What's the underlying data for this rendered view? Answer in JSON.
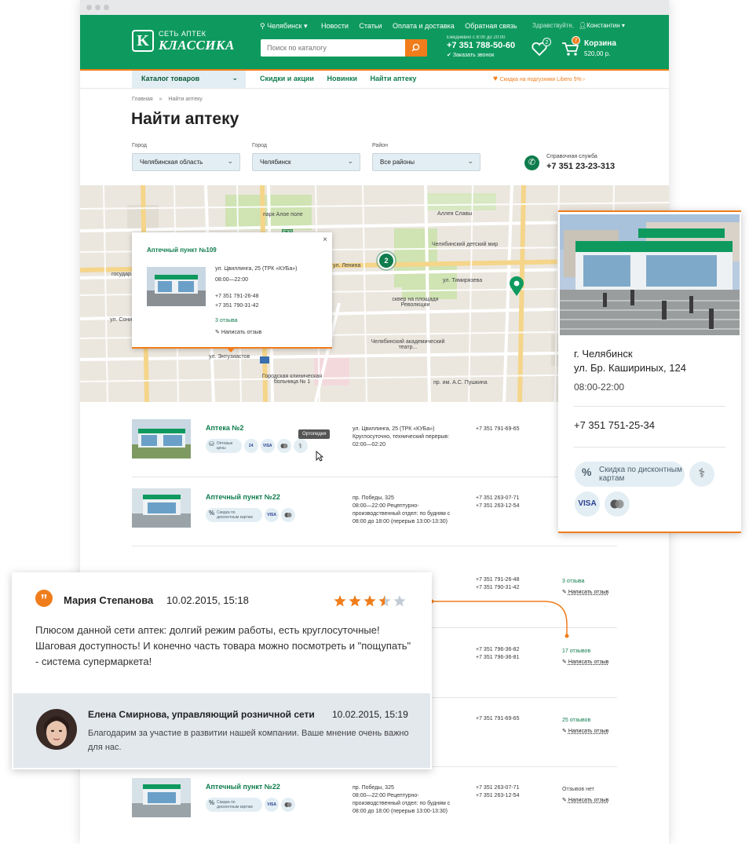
{
  "header": {
    "logo_line1": "СЕТЬ АПТЕК",
    "logo_line2": "КЛАССИКА",
    "city": "Челябинск",
    "nav": [
      "Новости",
      "Статьи",
      "Оплата и доставка",
      "Обратная связь"
    ],
    "search_placeholder": "Поиск по каталогу",
    "phone_schedule": "Ежедневно с 8:00 до 20:00",
    "phone": "+7 351 788-50-60",
    "callback": "Заказать звонок",
    "greeting": "Здравствуйте,",
    "user": "Константин",
    "favorites_count": "2",
    "cart_count": "7",
    "cart_label": "Корзина",
    "cart_sum": "520,00 р.",
    "colors": {
      "brand_green": "#0e9a5e",
      "accent_orange": "#f07d1b"
    }
  },
  "subnav": {
    "catalog": "Каталог товаров",
    "links": [
      "Скидки и акции",
      "Новинки",
      "Найти аптеку"
    ],
    "promo": "Скидка на подгузники Libero 5%"
  },
  "page": {
    "breadcrumb_home": "Главная",
    "breadcrumb_sep": "»",
    "breadcrumb_current": "Найти аптеку",
    "title": "Найти аптеку",
    "filters": [
      {
        "label": "Город",
        "value": "Челябинская область"
      },
      {
        "label": "Город",
        "value": "Челябинск"
      },
      {
        "label": "Район",
        "value": "Все районы"
      }
    ],
    "help_label": "Справочная служба",
    "help_phone": "+7 351 23-23-313"
  },
  "map": {
    "labels": [
      "парк Алое поле",
      "Аллея Славы",
      "ул. Коммуны",
      "ул. Свободы",
      "ул. Ленина",
      "ул. Тимирязева",
      "сквер на площади Революции",
      "Челябинский детский мир",
      "Челябинский академический театр...",
      "Городская клиническая больница № 1",
      "пр. им. А.С. Пушкина",
      "ул. Воровского",
      "ул. Лесной",
      "ул. Энтузиастов",
      "государ...",
      "ул. Сони",
      "ул. Худякова",
      "ул. Кирова",
      "M5",
      "E30"
    ],
    "cluster_count": "2",
    "popup": {
      "title": "Аптечный пункт №109",
      "address": "ул. Цвиллинга, 25 (ТРК «КУБа»)",
      "hours": "08:00—22:00",
      "phone1": "+7 351 791-26-48",
      "phone2": "+7 351 790-31-42",
      "reviews": "3 отзыва",
      "write": "Написать отзыв",
      "close": "×"
    }
  },
  "list": [
    {
      "name": "Аптека №2",
      "badges": [
        "Оптовые цены",
        "24",
        "VISA",
        "mc",
        "ortho"
      ],
      "address": "ул. Цвиллинга, 25 (ТРК «КУБа»)",
      "hours": "Круглосуточно, технический перерыв: 02:00—02:20",
      "phones": [
        "+7 351 791-69-65"
      ],
      "reviews": "",
      "write": ""
    },
    {
      "name": "Аптечный пункт №22",
      "badges": [
        "Скидка по дисконтным картам",
        "VISA",
        "mc"
      ],
      "address": "пр. Победы, 325",
      "hours": "08:00—22:00 Рецептурно-производственный отдел: по будням с 08:00 до 18:00 (перерыв 13:00-13:30)",
      "phones": [
        "+7 351 263-07-71",
        "+7 351 263-12-54"
      ],
      "reviews": "",
      "write": ""
    },
    {
      "name": "",
      "badges": [],
      "address": "",
      "hours": "",
      "phones": [
        "+7 351 791-26-48",
        "+7 351 790-31-42"
      ],
      "reviews": "3 отзыва",
      "write": "Написать отзыв"
    },
    {
      "name": "",
      "badges": [],
      "address": "",
      "hours": "",
      "phones": [
        "+7 351 796-36-82",
        "+7 351 796-36-81"
      ],
      "reviews": "17 отзывов",
      "write": "Написать отзыв"
    },
    {
      "name": "",
      "badges": [],
      "address": "",
      "hours": "",
      "phones": [
        "+7 351 791-69-65"
      ],
      "reviews": "25 отзывов",
      "write": "Написать отзыв"
    },
    {
      "name": "Аптечный пункт №22",
      "badges": [
        "Скидка по дисконтным картам",
        "VISA",
        "mc"
      ],
      "address": "пр. Победы, 325",
      "hours": "08:00—22:00 Рецептурно-производственный отдел: по будням с 08:00 до 18:00 (перерыв 13:00-13:30)",
      "phones": [
        "+7 351 263-07-71",
        "+7 351 263-12-54"
      ],
      "reviews": "Отзывов нет",
      "write": "Написать отзыв"
    }
  ],
  "tooltip": "Ортопедия",
  "detail_card": {
    "city": "г. Челябинск",
    "street": "ул. Бр. Кашириных, 124",
    "hours": "08:00-22:00",
    "phone": "+7 351 751-25-34",
    "discount": "Скидка по дисконтным картам",
    "visa": "VISA"
  },
  "review": {
    "author": "Мария Степанова",
    "date": "10.02.2015, 15:18",
    "rating": 3.5,
    "max_rating": 5,
    "text": "Плюсом данной сети аптек: долгий режим работы, есть круглосуточные! Шаговая доступность! И конечно часть товара можно посмотреть и \"пощупать\" - система супермаркета!",
    "reply_author": "Елена Смирнова, управляющий розничной сети",
    "reply_date": "10.02.2015, 15:19",
    "reply_text": "Благодарим за участие в развитии нашей компании. Ваше мнение очень важно для нас."
  }
}
